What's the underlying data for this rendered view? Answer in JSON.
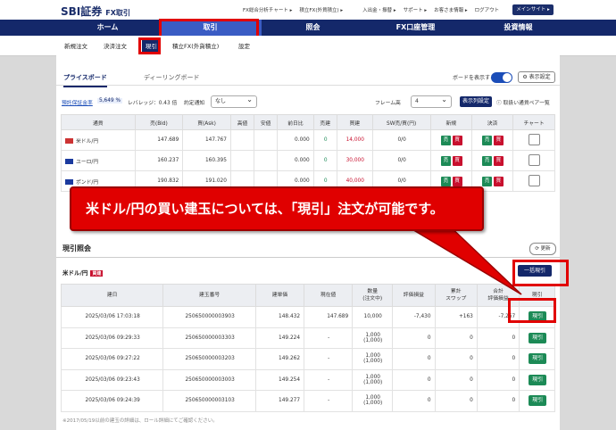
{
  "header": {
    "logo": "SBI証券",
    "product": "FX取引",
    "links": [
      "FX総合分析チャート ▸",
      "積立FX(外貨積立) ▸",
      "入出金・振替 ▸",
      "サポート ▸",
      "お客さま情報 ▸",
      "ログアウト"
    ],
    "main_site": "メインサイト ▸"
  },
  "nav": {
    "items": [
      "ホーム",
      "取引",
      "照会",
      "FX口座管理",
      "投資情報"
    ],
    "active": "取引"
  },
  "subnav": {
    "items": [
      "新規注文",
      "決済注文",
      "現引",
      "積立FX(外貨積立)",
      "設定"
    ],
    "active": "現引"
  },
  "tabs": {
    "active": "プライスボード",
    "other": "ディーリングボード"
  },
  "board_toggle": "ボードを表示する",
  "display_settings": "⚙ 表示設定",
  "toolbar": {
    "margin_rate_label": "預託保証金率",
    "margin_rate": "5,649 %",
    "leverage": "レバレッジ：0.43 倍",
    "preset_label": "約定通知",
    "preset_value": "なし",
    "frame_label": "フレーム高",
    "frame_value": "4",
    "display_columns": "表示列設定",
    "currency_pairs": "ⓘ 取扱い通貨ペア一覧"
  },
  "price_board": {
    "headers": [
      "通貨",
      "売(Bid)",
      "買(Ask)",
      "高値",
      "安値",
      "前日比",
      "売建",
      "買建",
      "SW売/買(円)",
      "新規",
      "決済",
      "チャート"
    ],
    "rows": [
      {
        "pair": "米ドル/円",
        "bid": "147.689",
        "ask": "147.767",
        "high": "",
        "low": "",
        "change": "0.000",
        "sell": "0",
        "buy": "14,000",
        "sw": "0/0"
      },
      {
        "pair": "ユーロ/円",
        "bid": "160.237",
        "ask": "160.395",
        "high": "",
        "low": "",
        "change": "0.000",
        "sell": "0",
        "buy": "30,000",
        "sw": "0/0"
      },
      {
        "pair": "ポンド/円",
        "bid": "190.832",
        "ask": "191.020",
        "high": "",
        "low": "",
        "change": "0.000",
        "sell": "0",
        "buy": "40,000",
        "sw": "0/0"
      }
    ],
    "sell_label": "売",
    "buy_label": "買"
  },
  "callout": "米ドル/円の買い建玉については、「現引」注文が可能です。",
  "inquiry": {
    "title": "現引照会",
    "refresh": "⟳ 更新",
    "pair": "米ドル/円",
    "side_badge": "買建",
    "bulk_button": "一括現引",
    "headers": [
      "建日",
      "建玉番号",
      "建単価",
      "現在値",
      "数量\n(注文中)",
      "評価損益",
      "累計\nスワップ",
      "合計\n評価損益",
      "現引"
    ],
    "rows": [
      {
        "date": "2025/03/06 17:03:18",
        "no": "250650000003903",
        "price": "148.432",
        "now": "147.689",
        "qty": "10,000",
        "qty2": "",
        "pl": "-7,430",
        "swap": "+163",
        "total": "-7,267"
      },
      {
        "date": "2025/03/06 09:29:33",
        "no": "250650000003303",
        "price": "149.224",
        "now": "-",
        "qty": "1,000",
        "qty2": "(1,000)",
        "pl": "0",
        "swap": "0",
        "total": "0"
      },
      {
        "date": "2025/03/06 09:27:22",
        "no": "250650000003203",
        "price": "149.262",
        "now": "-",
        "qty": "1,000",
        "qty2": "(1,000)",
        "pl": "0",
        "swap": "0",
        "total": "0"
      },
      {
        "date": "2025/03/06 09:23:43",
        "no": "250650000003003",
        "price": "149.254",
        "now": "-",
        "qty": "1,000",
        "qty2": "(1,000)",
        "pl": "0",
        "swap": "0",
        "total": "0"
      },
      {
        "date": "2025/03/06 09:24:39",
        "no": "250650000003103",
        "price": "149.277",
        "now": "-",
        "qty": "1,000",
        "qty2": "(1,000)",
        "pl": "0",
        "swap": "0",
        "total": "0"
      }
    ],
    "action_label": "現引",
    "footnote": "※2017/05/19以前の建玉の詳細は、ロール詳細にてご確認ください。"
  },
  "colors": {
    "accent": "#14286a",
    "highlight": "#e10000",
    "buy": "#c8102e",
    "sell": "#1c8a56"
  }
}
